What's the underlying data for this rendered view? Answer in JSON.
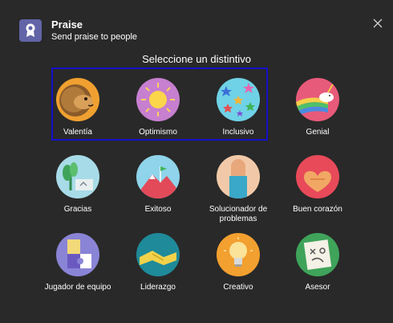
{
  "header": {
    "title": "Praise",
    "subtitle": "Send praise to people"
  },
  "heading": "Seleccione un distintivo",
  "badges": [
    {
      "label": "Valentía",
      "icon": "lion-icon",
      "selected": true
    },
    {
      "label": "Optimismo",
      "icon": "sun-icon",
      "selected": true
    },
    {
      "label": "Inclusivo",
      "icon": "stars-icon",
      "selected": true
    },
    {
      "label": "Genial",
      "icon": "unicorn-icon",
      "selected": false
    },
    {
      "label": "Gracias",
      "icon": "plant-card-icon",
      "selected": false
    },
    {
      "label": "Exitoso",
      "icon": "mountain-flag-icon",
      "selected": false
    },
    {
      "label": "Solucionador de problemas",
      "icon": "puzzle-fist-icon",
      "selected": false
    },
    {
      "label": "Buen corazón",
      "icon": "heart-hands-icon",
      "selected": false
    },
    {
      "label": "Jugador de equipo",
      "icon": "team-puzzle-icon",
      "selected": false
    },
    {
      "label": "Liderazgo",
      "icon": "handshake-icon",
      "selected": false
    },
    {
      "label": "Creativo",
      "icon": "lightbulb-icon",
      "selected": false
    },
    {
      "label": "Asesor",
      "icon": "strategy-board-icon",
      "selected": false
    }
  ],
  "colors": {
    "background": "#292929",
    "accent": "#6264a7",
    "selection_border": "#1510c8"
  }
}
